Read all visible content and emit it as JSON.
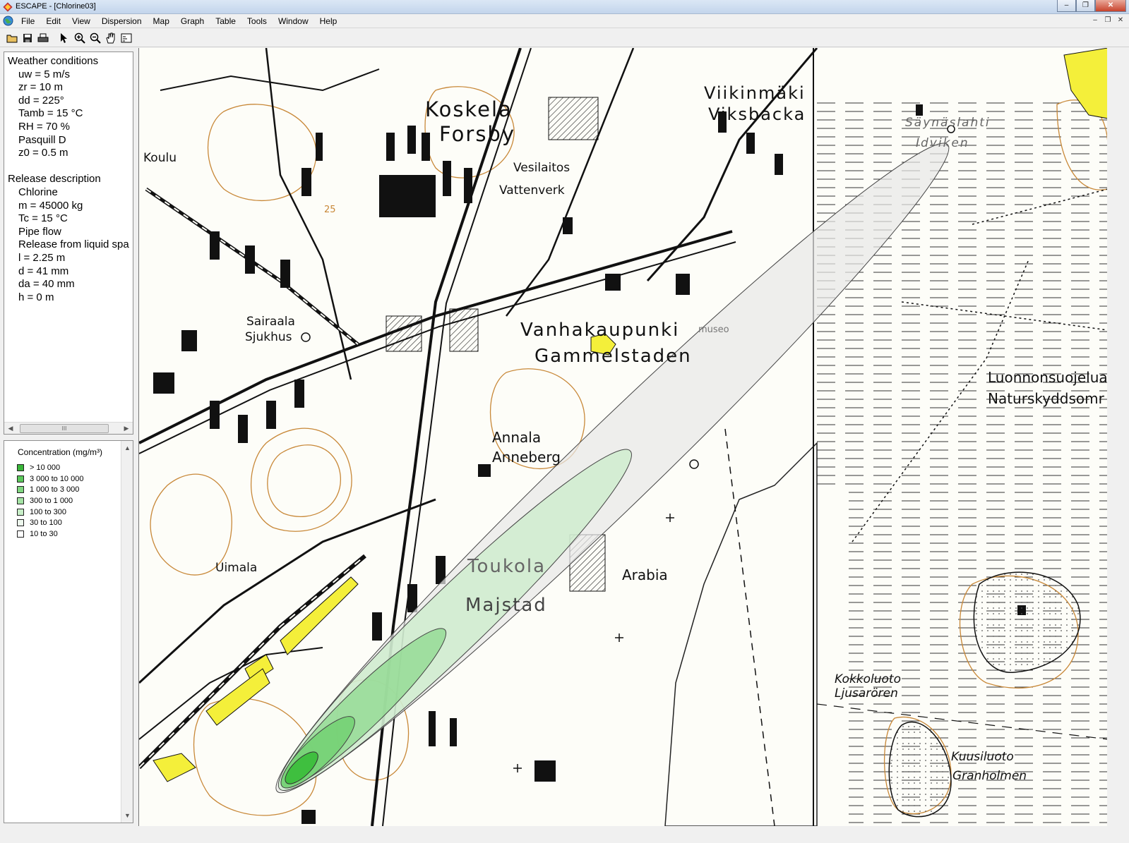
{
  "window": {
    "title": "ESCAPE - [Chlorine03]",
    "buttons": [
      "–",
      "❐",
      "✕"
    ]
  },
  "menu": {
    "items": [
      "File",
      "Edit",
      "View",
      "Dispersion",
      "Map",
      "Graph",
      "Table",
      "Tools",
      "Window",
      "Help"
    ],
    "mdi_buttons": [
      "–",
      "❐",
      "✕"
    ]
  },
  "toolbar": {
    "icons": [
      "open-folder-icon",
      "save-icon",
      "print-icon",
      "pointer-icon",
      "zoom-in-icon",
      "zoom-out-icon",
      "pan-hand-icon",
      "full-extent-icon"
    ]
  },
  "info": {
    "weather_title": "Weather conditions",
    "weather": [
      "uw = 5 m/s",
      "zr = 10 m",
      "dd = 225°",
      "Tamb = 15 °C",
      "RH = 70 %",
      "Pasquill D",
      "z0 = 0.5 m"
    ],
    "release_title": "Release description",
    "release": [
      "Chlorine",
      "m = 45000 kg",
      "Tc = 15 °C",
      "Pipe flow",
      "Release from liquid spa",
      "l = 2.25 m",
      "d = 41 mm",
      "da = 40 mm",
      "h = 0 m"
    ],
    "scroll_thumb": "III"
  },
  "legend": {
    "title": "Concentration (mg/m³)",
    "rows": [
      {
        "range": ">  10 000",
        "color": "#39b539"
      },
      {
        "range": "3 000 to  10 000",
        "color": "#5bc85b"
      },
      {
        "range": "1 000 to   3 000",
        "color": "#7fd67f"
      },
      {
        "range": "300 to    1 000",
        "color": "#a4e3a4"
      },
      {
        "range": "100 to     300",
        "color": "#c8efc8"
      },
      {
        "range": "30 to     100",
        "color": "#eef8ee"
      },
      {
        "range": "10 to      30",
        "color": "#ffffff"
      }
    ]
  },
  "map": {
    "labels": [
      "Koskela",
      "Forsby",
      "Viikinmäki",
      "Viksbacka",
      "Vesilaitos",
      "Vattenverk",
      "Sairaala",
      "Sjukhus",
      "Vanhakaupunki",
      "Gammelstaden",
      "Annala",
      "Anneberg",
      "Toukola",
      "Majstad",
      "Arabia",
      "Uimala",
      "Luonnonsuojelua",
      "Naturskyddsomr",
      "Kokkoluoto",
      "Ljusarören",
      "Kuusiluoto",
      "Granholmen",
      "Säynäslahti",
      "Idviken",
      "Koulu",
      "museo",
      "25"
    ],
    "plume_colors": {
      "outer": "#e8e8e8",
      "core": "#3fbf3f",
      "mid": "#8ed88e",
      "pale": "#c9ecc9"
    },
    "zone_color": "#f4ef3a",
    "contour_color": "#c88838"
  }
}
